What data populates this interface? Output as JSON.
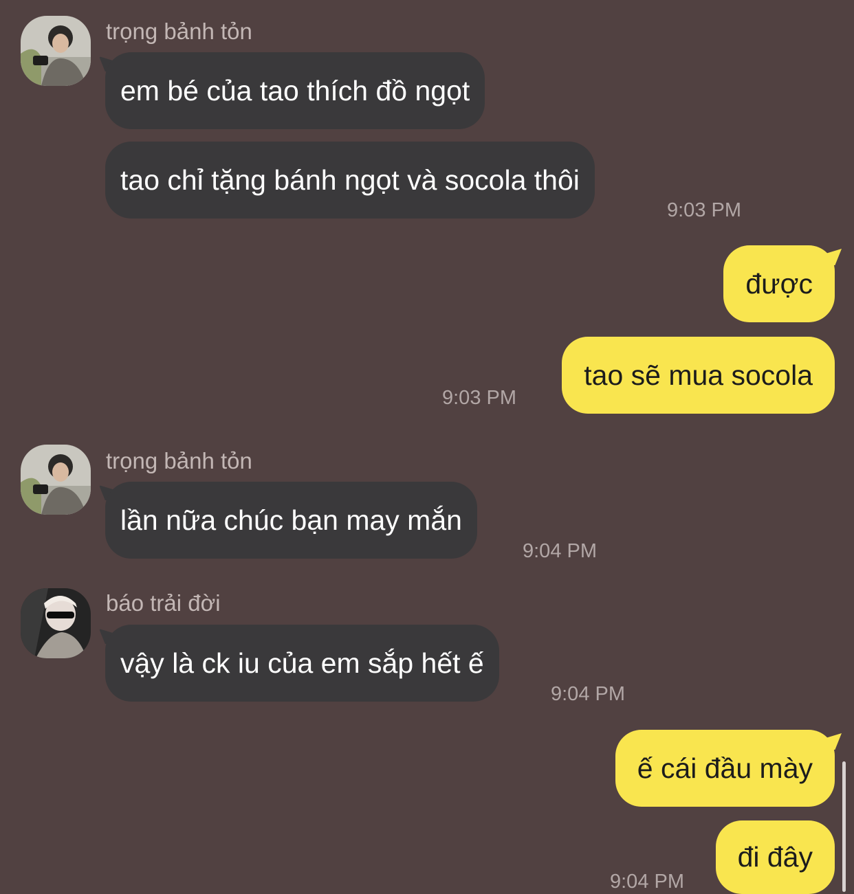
{
  "messages": [
    {
      "sender": "trọng bảnh tỏn",
      "avatar_icon": "avatar-photo-icon",
      "texts": [
        "em bé của tao thích đồ ngọt",
        "tao chỉ tặng bánh ngọt và socola thôi"
      ],
      "time": "9:03 PM"
    },
    {
      "sender": "me",
      "texts": [
        "được",
        "tao sẽ mua socola"
      ],
      "time": "9:03 PM"
    },
    {
      "sender": "trọng bảnh tỏn",
      "avatar_icon": "avatar-photo-icon",
      "texts": [
        "lần nữa chúc bạn may mắn"
      ],
      "time": "9:04 PM"
    },
    {
      "sender": "báo trải đời",
      "avatar_icon": "avatar-sunglasses-icon",
      "texts": [
        "vậy là ck iu của em sắp hết ế"
      ],
      "time": "9:04 PM"
    },
    {
      "sender": "me",
      "texts": [
        "ế cái đầu mày",
        "đi đây"
      ],
      "time": "9:04 PM"
    }
  ],
  "colors": {
    "background": "#514141",
    "incoming_bubble": "#3a393b",
    "outgoing_bubble": "#f9e54f"
  }
}
